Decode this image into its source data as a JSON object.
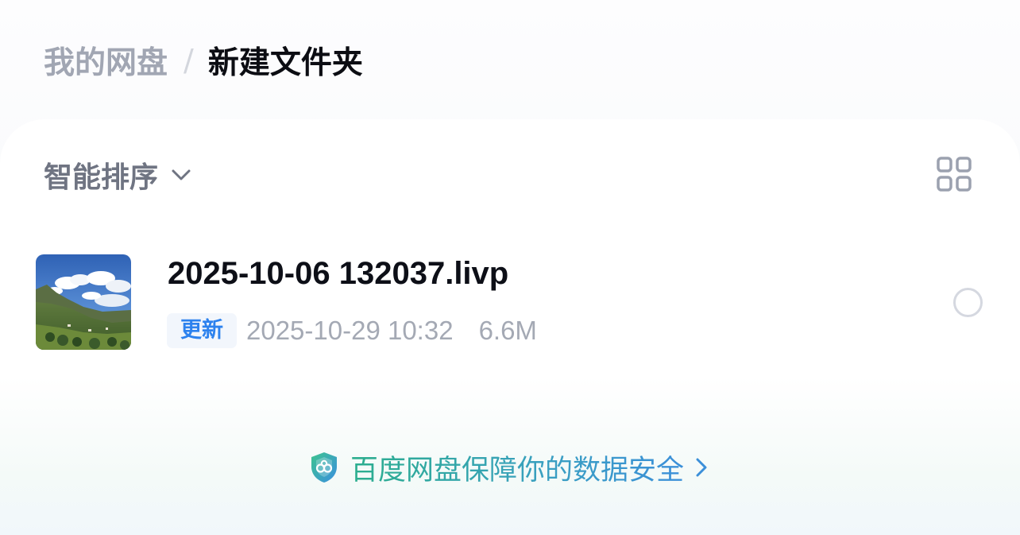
{
  "breadcrumb": {
    "root": "我的网盘",
    "separator": "/",
    "current": "新建文件夹"
  },
  "toolbar": {
    "sort_label": "智能排序",
    "sort_icon": "chevron-down-icon",
    "view_toggle_icon": "grid-view-icon"
  },
  "files": [
    {
      "name": "2025-10-06 132037.livp",
      "tag": "更新",
      "modified": "2025-10-29 10:32",
      "size": "6.6M",
      "thumbnail": "mountain-landscape-photo",
      "selected": false
    }
  ],
  "footer": {
    "security_text": "百度网盘保障你的数据安全",
    "icon": "shield-icon",
    "arrow_icon": "chevron-right-icon"
  },
  "colors": {
    "tag_blue": "#2d82ee",
    "title_dark": "#0c0d13",
    "muted_gray": "#a1a6b3",
    "security_green": "#2cae8e",
    "security_blue": "#3b8fd9"
  }
}
